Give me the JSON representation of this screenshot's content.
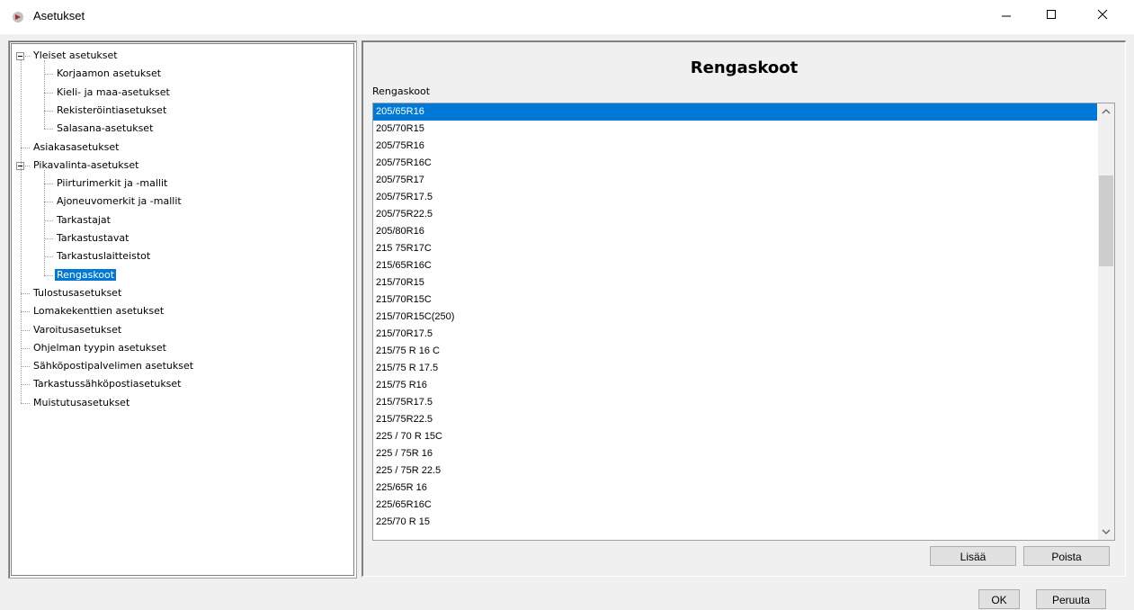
{
  "window": {
    "title": "Asetukset"
  },
  "tree": {
    "items": [
      {
        "label": "Yleiset asetukset",
        "level": 0,
        "expander": true
      },
      {
        "label": "Korjaamon asetukset",
        "level": 1
      },
      {
        "label": "Kieli- ja maa-asetukset",
        "level": 1
      },
      {
        "label": "Rekisteröintiasetukset",
        "level": 1
      },
      {
        "label": "Salasana-asetukset",
        "level": 1
      },
      {
        "label": "Asiakasasetukset",
        "level": 0
      },
      {
        "label": "Pikavalinta-asetukset",
        "level": 0,
        "expander": true
      },
      {
        "label": "Piirturimerkit ja -mallit",
        "level": 1
      },
      {
        "label": "Ajoneuvomerkit ja -mallit",
        "level": 1
      },
      {
        "label": "Tarkastajat",
        "level": 1
      },
      {
        "label": "Tarkastustavat",
        "level": 1
      },
      {
        "label": "Tarkastuslaitteistot",
        "level": 1
      },
      {
        "label": "Rengaskoot",
        "level": 1,
        "selected": true
      },
      {
        "label": "Tulostusasetukset",
        "level": 0
      },
      {
        "label": "Lomakekenttien asetukset",
        "level": 0
      },
      {
        "label": "Varoitusasetukset",
        "level": 0
      },
      {
        "label": "Ohjelman tyypin asetukset",
        "level": 0
      },
      {
        "label": "Sähköpostipalvelimen asetukset",
        "level": 0
      },
      {
        "label": "Tarkastussähköpostiasetukset",
        "level": 0
      },
      {
        "label": "Muistutusasetukset",
        "level": 0
      }
    ]
  },
  "main": {
    "heading": "Rengaskoot",
    "list_label": "Rengaskoot",
    "selected_index": 0,
    "items": [
      "205/65R16",
      "205/70R15",
      "205/75R16",
      "205/75R16C",
      "205/75R17",
      "205/75R17.5",
      "205/75R22.5",
      "205/80R16",
      "215 75R17C",
      "215/65R16C",
      "215/70R15",
      "215/70R15C",
      "215/70R15C(250)",
      "215/70R17.5",
      "215/75 R 16 C",
      "215/75 R 17.5",
      "215/75 R16",
      "215/75R17.5",
      "215/75R22.5",
      "225 / 70 R 15C",
      "225 / 75R  16",
      "225 / 75R  22.5",
      "225/65R 16",
      "225/65R16C",
      "225/70 R 15"
    ],
    "add_label": "Lisää",
    "remove_label": "Poista"
  },
  "footer": {
    "ok_label": "OK",
    "cancel_label": "Peruuta"
  },
  "colors": {
    "selection": "#0078d7",
    "window_bg": "#f0f0f0"
  }
}
